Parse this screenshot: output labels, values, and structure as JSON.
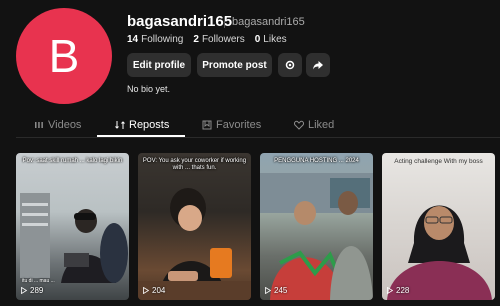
{
  "profile": {
    "avatar_letter": "B",
    "avatar_color": "#e8334f",
    "username": "bagasandri165",
    "handle": "bagasandri165",
    "stats": [
      {
        "value": "14",
        "label": "Following"
      },
      {
        "value": "2",
        "label": "Followers"
      },
      {
        "value": "0",
        "label": "Likes"
      }
    ],
    "edit_label": "Edit profile",
    "promote_label": "Promote post",
    "settings_icon": "settings-icon",
    "share_icon": "share-icon",
    "bio": "No bio yet."
  },
  "tabs": [
    {
      "label": "Videos",
      "icon": "grid-icon",
      "active": false
    },
    {
      "label": "Reposts",
      "icon": "repost-icon",
      "active": true
    },
    {
      "label": "Favorites",
      "icon": "bookmark-icon",
      "active": false
    },
    {
      "label": "Liked",
      "icon": "heart-icon",
      "active": false
    }
  ],
  "videos": [
    {
      "caption": "Pov: saat skill rumah ... kalo lagi bikin",
      "sub": "itu di ... mau ...",
      "views": "289"
    },
    {
      "caption": "POV: You ask your coworker if working with ... thats fun.",
      "sub": "",
      "views": "204"
    },
    {
      "caption": "PENGGUNA HOSTING ... 2024",
      "sub": "",
      "views": "245"
    },
    {
      "caption": "Acting challenge With my boss",
      "sub": "",
      "views": "228"
    }
  ]
}
